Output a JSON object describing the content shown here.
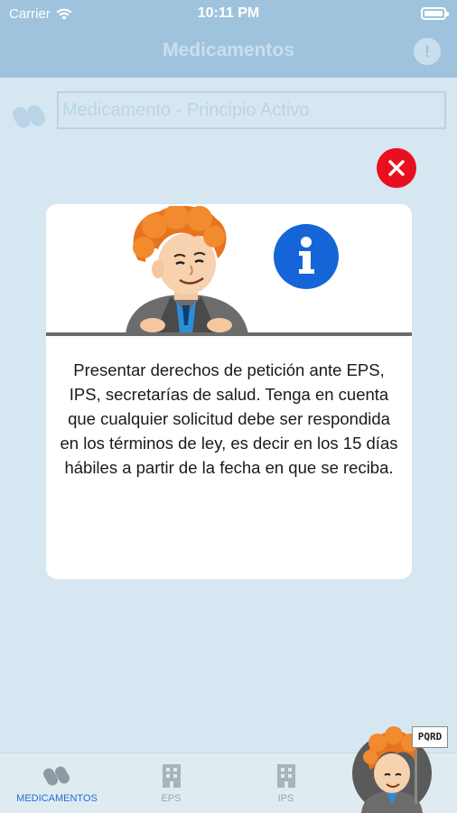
{
  "status_bar": {
    "carrier": "Carrier",
    "time": "10:11 PM"
  },
  "nav": {
    "title": "Medicamentos"
  },
  "search": {
    "placeholder": "Medicamento - Principio Activo"
  },
  "modal": {
    "text": "Presentar derechos de petición ante EPS, IPS, secretarías de salud. Tenga en cuenta que cualquier solicitud debe ser respondida en los términos de ley, es decir en los 15 días hábiles a partir de la fecha en que se reciba."
  },
  "tabs": [
    {
      "label": "MEDICAMENTOS",
      "icon": "pills-icon",
      "active": true
    },
    {
      "label": "EPS",
      "icon": "building-icon",
      "active": false
    },
    {
      "label": "IPS",
      "icon": "building-icon",
      "active": false
    }
  ],
  "fab": {
    "sign": "PQRD",
    "icon": "mascot-icon"
  },
  "colors": {
    "accent": "#1e6fd9",
    "close": "#e8101e",
    "info_blue": "#1565d8",
    "overlay": "#d6e7f2"
  }
}
